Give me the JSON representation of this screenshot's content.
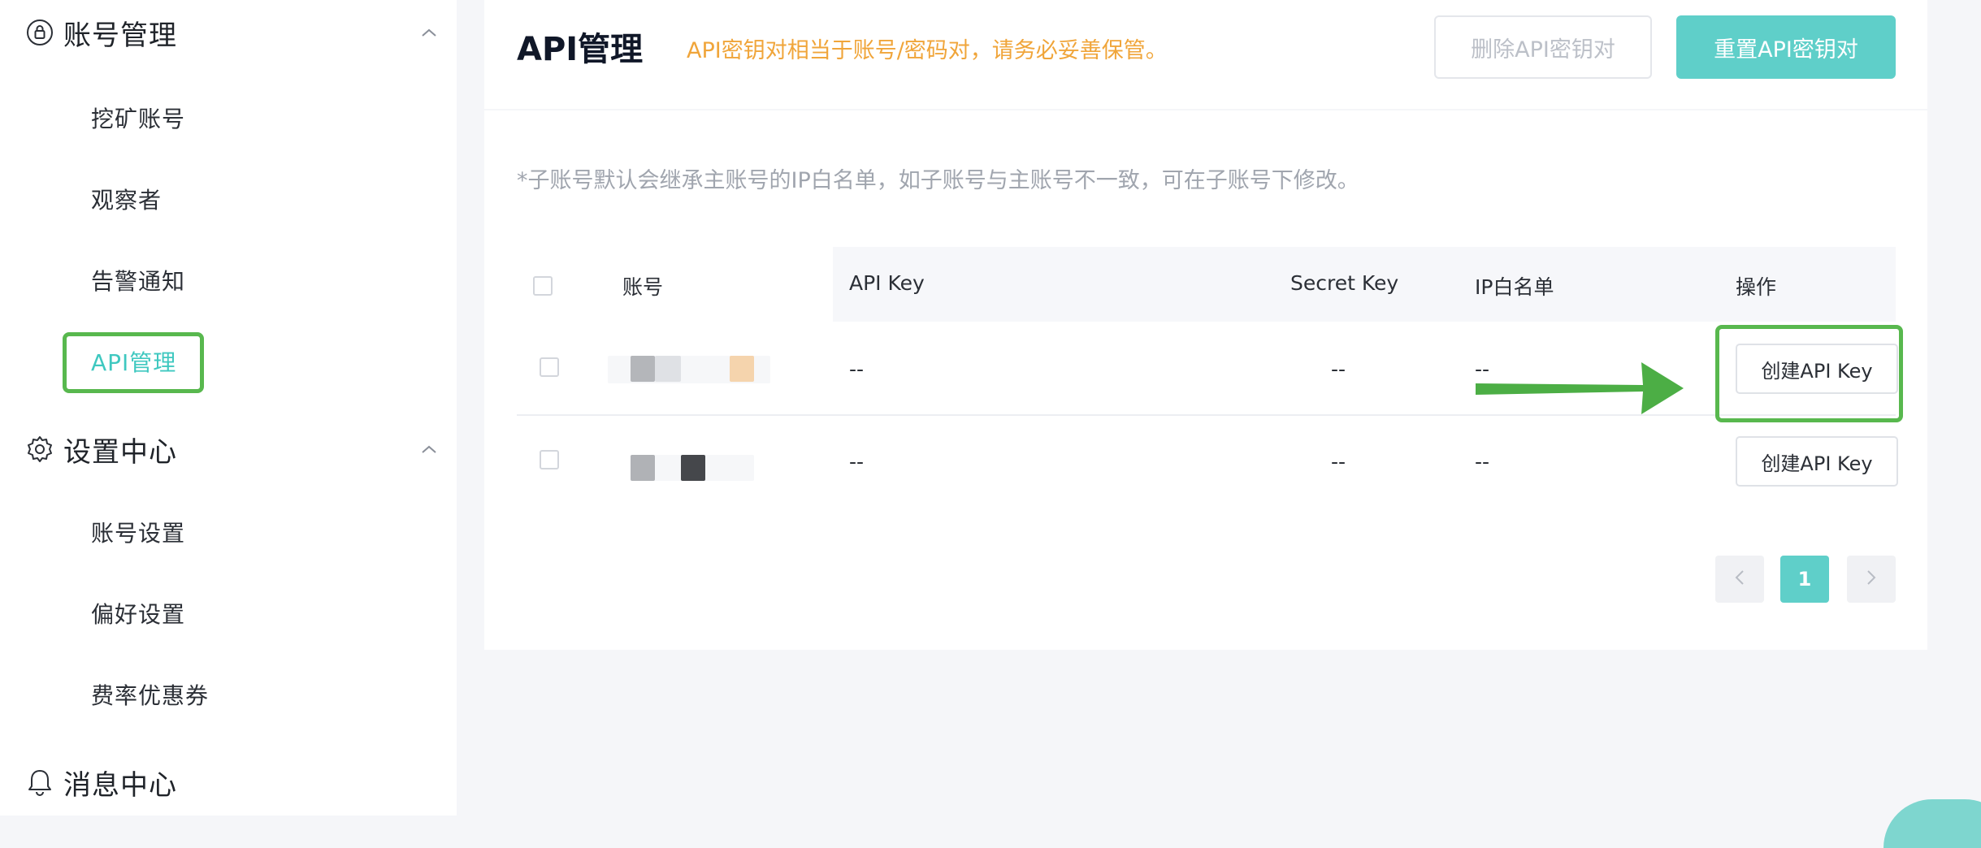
{
  "sidebar": {
    "groups": [
      {
        "label": "账号管理",
        "icon": "lock-circle-icon",
        "expanded": true,
        "items": [
          "挖矿账号",
          "观察者",
          "告警通知",
          "API管理"
        ]
      },
      {
        "label": "设置中心",
        "icon": "gear-icon",
        "expanded": true,
        "items": [
          "账号设置",
          "偏好设置",
          "费率优惠券"
        ]
      },
      {
        "label": "消息中心",
        "icon": "bell-icon"
      }
    ],
    "active_item": "API管理"
  },
  "header": {
    "title": "API管理",
    "tip": "API密钥对相当于账号/密码对，请务必妥善保管。",
    "delete_button": "删除API密钥对",
    "reset_button": "重置API密钥对"
  },
  "note": "*子账号默认会继承主账号的IP白名单，如子账号与主账号不一致，可在子账号下修改。",
  "table": {
    "columns": [
      "账号",
      "API Key",
      "Secret Key",
      "IP白名单",
      "操作"
    ],
    "rows": [
      {
        "api_key": "--",
        "secret_key": "--",
        "ip_whitelist": "--",
        "action": "创建API Key"
      },
      {
        "api_key": "--",
        "secret_key": "--",
        "ip_whitelist": "--",
        "action": "创建API Key"
      }
    ]
  },
  "pagination": {
    "current_page": "1",
    "prev_icon": "chevron-left-icon",
    "next_icon": "chevron-right-icon"
  },
  "colors": {
    "accent": "#5fcfc9",
    "warning_text": "#f0a53a",
    "annotation_green": "#58b84e"
  }
}
